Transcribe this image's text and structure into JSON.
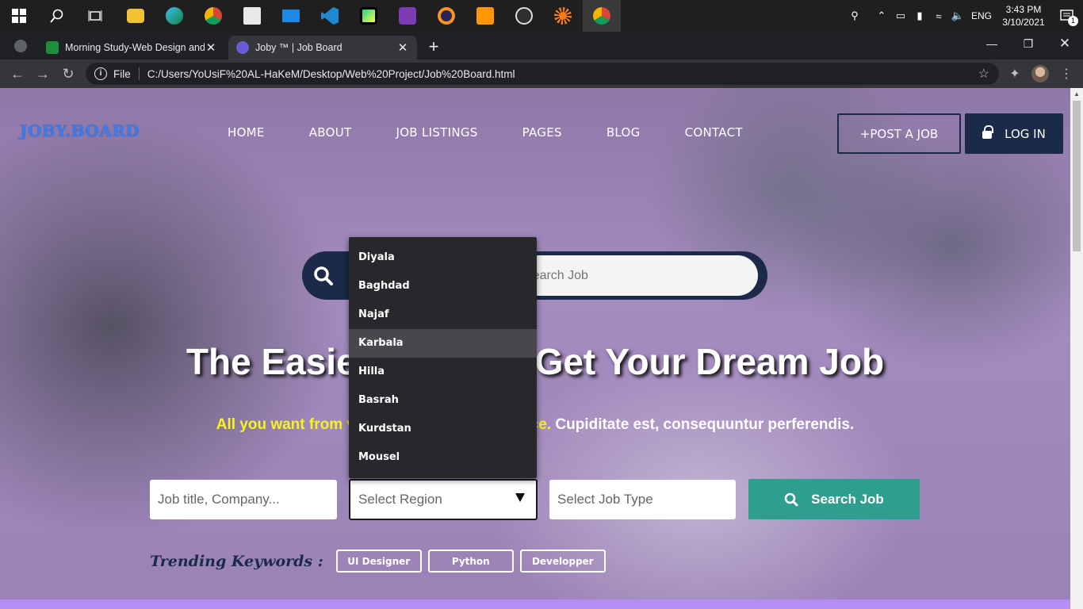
{
  "taskbar": {
    "icons": [
      "windows-start-icon",
      "search-icon",
      "task-view-icon",
      "file-explorer-icon",
      "edge-icon",
      "chrome-icon",
      "store-icon",
      "mail-icon",
      "vscode-icon",
      "pycharm-icon",
      "visual-studio-icon",
      "eclipse-icon",
      "sublime-text-icon",
      "obs-icon",
      "app-icon",
      "chrome-active-icon"
    ],
    "language": "ENG",
    "time": "3:43 PM",
    "date": "3/10/2021",
    "notification_count": "1"
  },
  "browser": {
    "tabs": [
      {
        "title": "Morning Study-Web Design and",
        "active": false
      },
      {
        "title": "Joby ™ | Job Board",
        "active": true
      }
    ],
    "url_scheme_label": "File",
    "url": "C:/Users/YoUsiF%20AL-HaKeM/Desktop/Web%20Project/Job%20Board.html"
  },
  "page": {
    "logo": "JOBY.BOARD",
    "nav": [
      "HOME",
      "ABOUT",
      "JOB LISTINGS",
      "PAGES",
      "BLOG",
      "CONTACT"
    ],
    "post_job": "+POST A JOB",
    "login": "LOG IN",
    "search_placeholder": "Search Job",
    "headline": "The Easiest Way To Get Your Dream Job",
    "subline_yellow": "All you want from vacancies to the experience.",
    "subline_white": " Cupiditate est, consequuntur perferendis.",
    "form": {
      "title_placeholder": "Job title, Company...",
      "region_value": "Select Region",
      "job_type_value": "Select Job Type",
      "search_button": "Search Job"
    },
    "region_options": [
      "Diyala",
      "Baghdad",
      "Najaf",
      "Karbala",
      "Hilla",
      "Basrah",
      "Kurdstan",
      "Mousel"
    ],
    "highlighted_option": "Karbala",
    "trending_label": "Trending Keywords :",
    "keywords": [
      "UI Designer",
      "Python",
      "Developper"
    ]
  },
  "colors": {
    "brand_navy": "#1b2a48",
    "logo_blue": "#3d7be8",
    "accent_teal": "#2e9e8f",
    "highlight_yellow": "#f5f51c",
    "dropdown_bg": "#28282c"
  }
}
